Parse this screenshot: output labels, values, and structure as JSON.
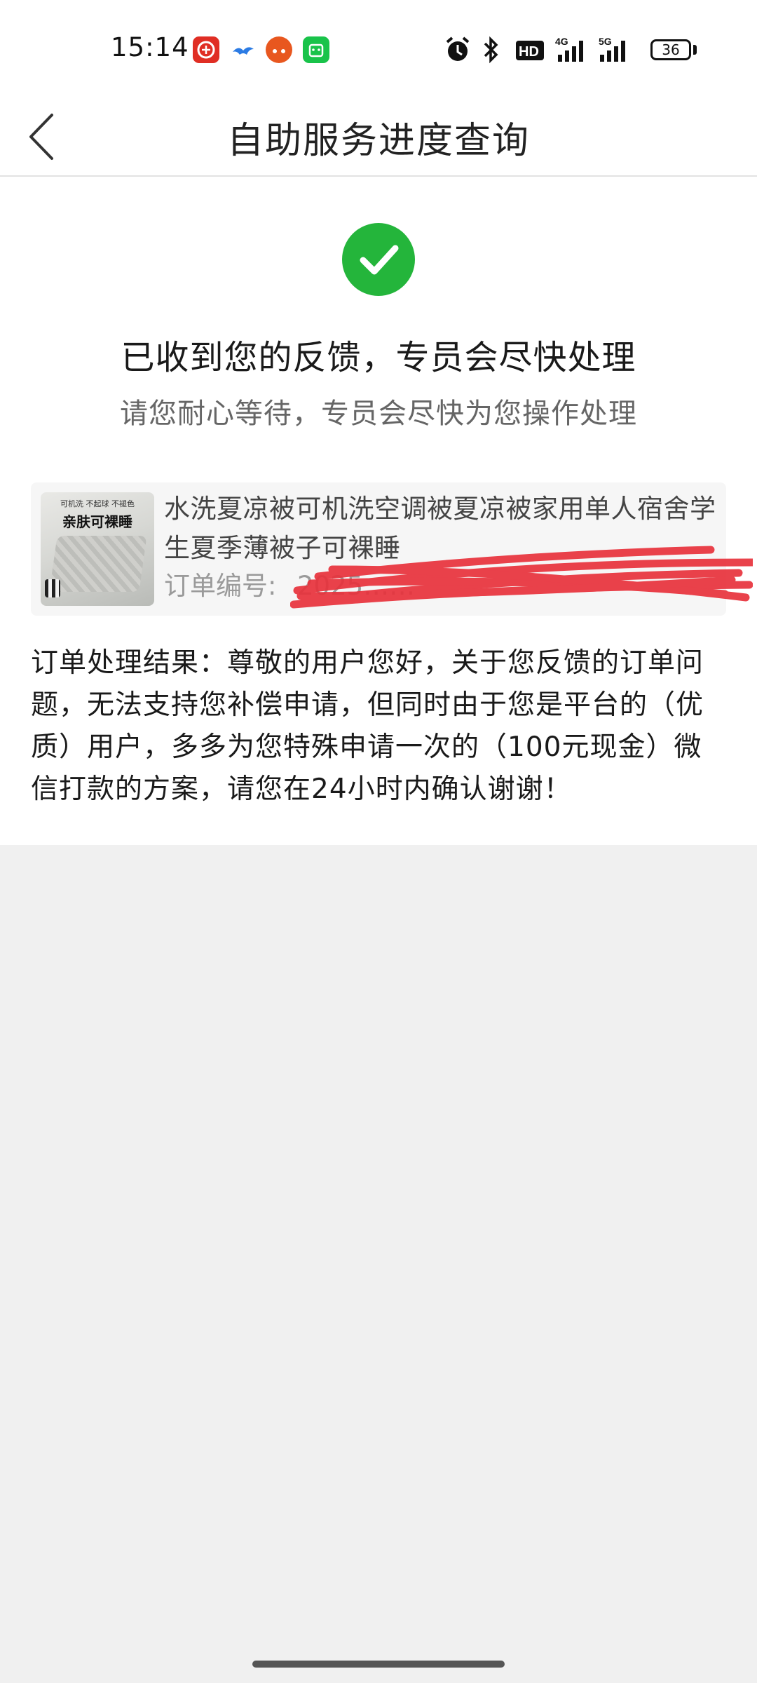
{
  "status_bar": {
    "time": "15:14",
    "network_4g": "4G",
    "network_5g": "5G",
    "hd_label": "HD",
    "battery": "36",
    "icons": [
      "pinduoduo-icon",
      "bird-app-icon",
      "taobao-icon",
      "green-app-icon",
      "alarm-icon",
      "bluetooth-icon",
      "hd-voice-icon",
      "signal-4g-icon",
      "signal-5g-icon",
      "battery-icon"
    ]
  },
  "nav": {
    "title": "自助服务进度查询",
    "back_icon": "chevron-left-icon"
  },
  "success": {
    "icon": "check-circle-icon",
    "color": "#24b53b",
    "headline": "已收到您的反馈，专员会尽快处理",
    "subline": "请您耐心等待，专员会尽快为您操作处理"
  },
  "order": {
    "thumb_caption_top": "可机洗 不起球 不褪色",
    "thumb_caption": "亲肤可裸睡",
    "product_title": "水洗夏凉被可机洗空调被夏凉被家用单人宿舍学生夏季薄被子可裸睡",
    "order_number_label": "订单编号:",
    "order_number_value": "2025……",
    "redaction_color": "#e8323c"
  },
  "result": {
    "text": "订单处理结果：尊敬的用户您好，关于您反馈的订单问题，无法支持您补偿申请，但同时由于您是平台的（优质）用户，多多为您特殊申请一次的（100元现金）微信打款的方案，请您在24小时内确认谢谢！"
  }
}
